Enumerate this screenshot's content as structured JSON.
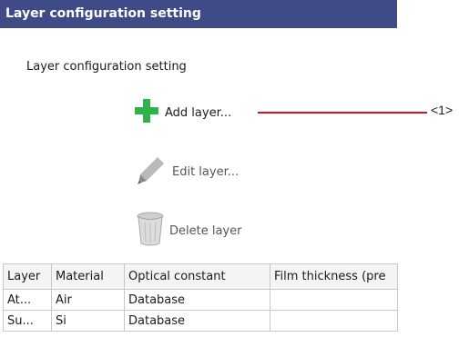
{
  "window": {
    "title": "Layer configuration setting"
  },
  "section": {
    "label": "Layer configuration setting"
  },
  "actions": {
    "add": "Add layer...",
    "edit": "Edit layer...",
    "delete": "Delete layer"
  },
  "callout": {
    "label": "<1>",
    "color": "#d4151e"
  },
  "table": {
    "headers": [
      "Layer",
      "Material",
      "Optical constant",
      "Film thickness (pre"
    ],
    "rows": [
      [
        "At...",
        "Air",
        "Database",
        ""
      ],
      [
        "Su...",
        "Si",
        "Database",
        ""
      ]
    ]
  },
  "colors": {
    "titlebar": "#3f4b86",
    "add_icon": "#2db34a"
  }
}
